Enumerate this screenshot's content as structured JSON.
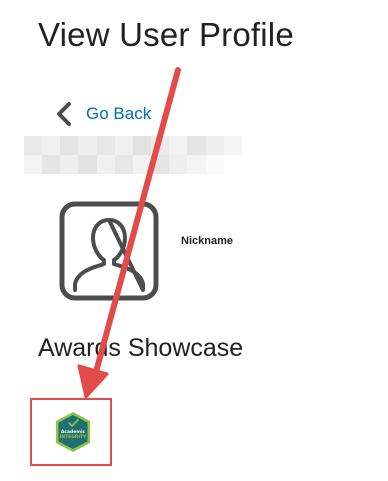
{
  "page": {
    "title": "View User Profile"
  },
  "nav": {
    "go_back_label": "Go Back"
  },
  "profile": {
    "nickname_label": "Nickname"
  },
  "awards": {
    "section_title": "Awards Showcase",
    "badges": [
      {
        "line1": "Academic",
        "line2": "INTEGRITY"
      }
    ]
  },
  "colors": {
    "link": "#006fbf",
    "annotation": "#e34a4a",
    "badge_fill": "#1f6f75",
    "badge_border": "#8fc63f"
  }
}
